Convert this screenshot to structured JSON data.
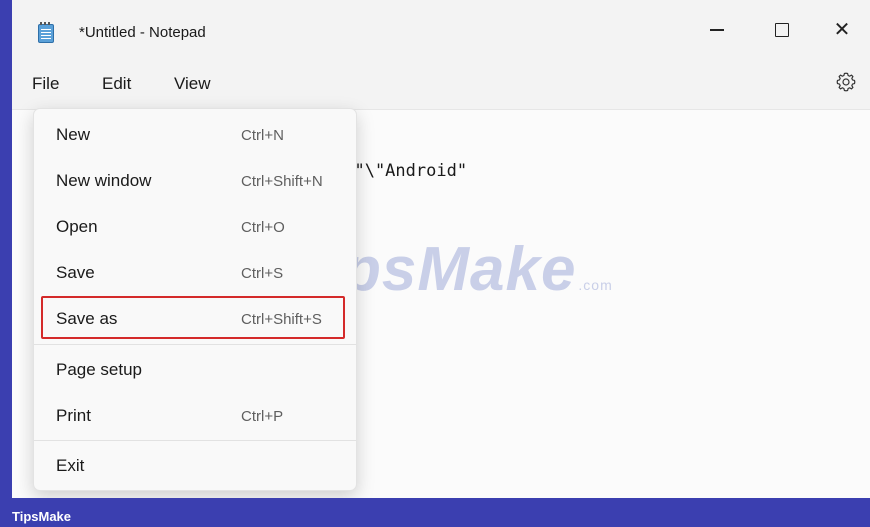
{
  "window": {
    "title": "*Untitled - Notepad"
  },
  "menubar": {
    "file": "File",
    "edit": "Edit",
    "view": "View"
  },
  "editor": {
    "visible_text": "eb\"\\\"Android\""
  },
  "watermark": {
    "brand": "TipsMake",
    "suffix": ".com"
  },
  "file_menu": {
    "items": [
      {
        "label": "New",
        "shortcut": "Ctrl+N"
      },
      {
        "label": "New window",
        "shortcut": "Ctrl+Shift+N"
      },
      {
        "label": "Open",
        "shortcut": "Ctrl+O"
      },
      {
        "label": "Save",
        "shortcut": "Ctrl+S"
      },
      {
        "label": "Save as",
        "shortcut": "Ctrl+Shift+S",
        "highlighted": true
      },
      {
        "label": "Page setup",
        "shortcut": ""
      },
      {
        "label": "Print",
        "shortcut": "Ctrl+P"
      },
      {
        "label": "Exit",
        "shortcut": ""
      }
    ]
  },
  "footer": {
    "label": "TipsMake"
  },
  "colors": {
    "background": "#3b3fb0",
    "highlight_border": "#d42a2a"
  },
  "icons": {
    "app": "notepad-icon",
    "settings": "gear-icon",
    "minimize": "minimize-icon",
    "maximize": "maximize-icon",
    "close": "close-icon"
  }
}
